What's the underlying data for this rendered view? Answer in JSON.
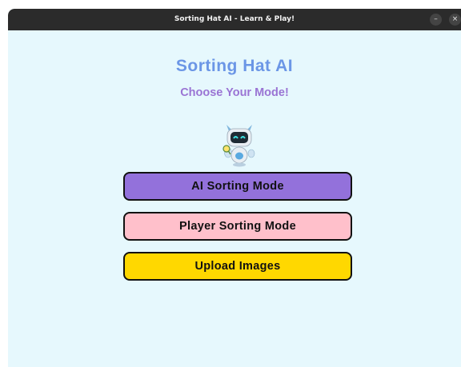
{
  "window": {
    "title": "Sorting Hat AI - Learn & Play!",
    "minimize_glyph": "–",
    "close_glyph": "×"
  },
  "main": {
    "title": "Sorting Hat AI",
    "subtitle": "Choose Your Mode!",
    "mascot_icon": "robot-icon",
    "buttons": {
      "ai_sorting": "AI Sorting Mode",
      "player_sorting": "Player Sorting Mode",
      "upload_images": "Upload Images"
    }
  },
  "colors": {
    "background": "#e6f8fd",
    "title": "#6b96e6",
    "subtitle": "#9a74d4",
    "ai_button": "#9371db",
    "player_button": "#ffc0cb",
    "upload_button": "#ffd800"
  }
}
